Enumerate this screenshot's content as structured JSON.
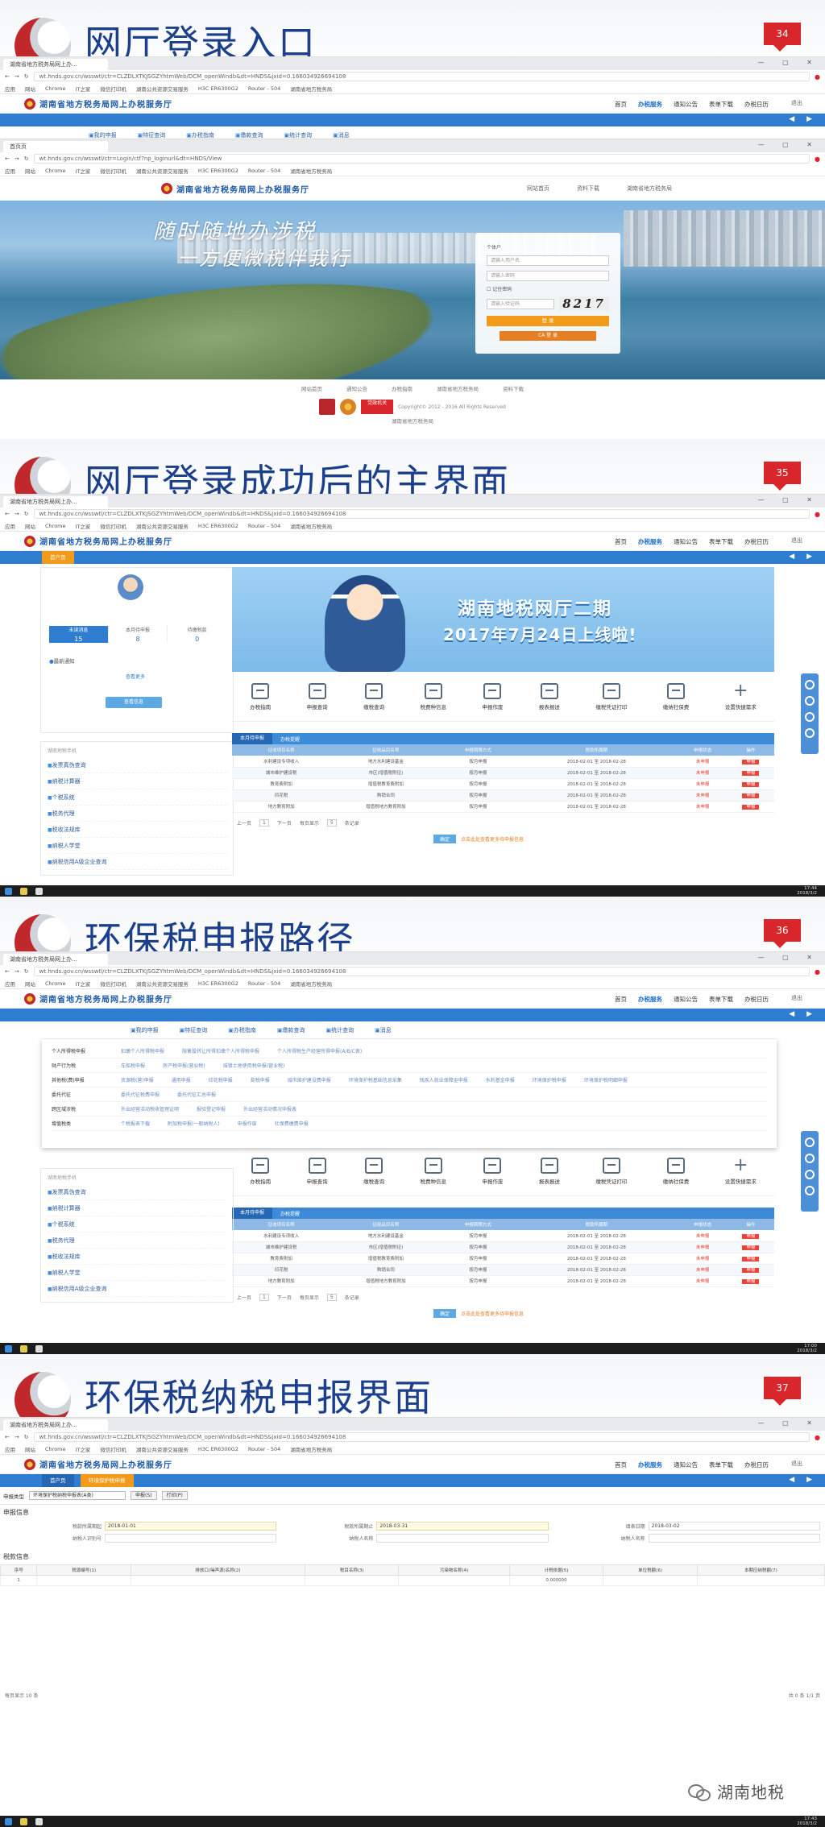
{
  "slides": [
    {
      "title": "网厅登录入口",
      "page": "34",
      "browser": {
        "tab": "湖南省地方税务局网上办...",
        "tab2": "首页页",
        "url": "wt.hnds.gov.cn/wsswtl/ctr=CLZDLXTKJSGZYhtmWeb/DCM_openWindb&dt=HNDS&jxid=0.166034926694108",
        "url2": "wt.hnds.gov.cn/wsswtl/ctr=Login/ctf?np_loginurl&dt=HNDS/View",
        "bookmarks": [
          "应用",
          "网站",
          "Chrome",
          "IT之家",
          "微信打印机",
          "湖南公共资源交易服务",
          "H3C ER6300G2",
          "Router - 504",
          "湖南省地方税务局"
        ]
      },
      "site_name": "湖南省地方税务局网上办税服务厅",
      "topnav": [
        "首页",
        "办税服务",
        "通知公告",
        "表单下载",
        "办税日历"
      ],
      "user": "退出",
      "subtabs": [
        "我的申报",
        "特征查询",
        "办税指南",
        "缴款查询",
        "统计查询",
        "消息"
      ],
      "login_links": [
        "网站首页",
        "资料下载",
        "湖南省地方税务局"
      ],
      "slogan1": "随时随地办涉税",
      "slogan2": "一方便微税伴我行",
      "login": {
        "tab": "个体户",
        "user_placeholder": "请输入用户名",
        "pwd_placeholder": "请输入密码",
        "remember": "记住密码",
        "captcha_placeholder": "请输入验证码",
        "captcha": "8217",
        "login_btn": "登 录",
        "cert_btn": "CA 登 录"
      },
      "footer_links": [
        "网站首页",
        "通知公告",
        "办税指南",
        "湖南省地方税务局",
        "资料下载"
      ],
      "copyright": "Copyright© 2012 - 2016 All Rights Reserved",
      "sponsor": "湖南省地方税务局",
      "gov_badge": "党政机关"
    },
    {
      "title": "网厅登录成功后的主界面",
      "page": "35",
      "url": "wt.hnds.gov.cn/wsswtl/ctr=CLZDLXTKJSGZYhtmWeb/DCM_openWindb&dt=HNDS&jxid=0.166034926694108",
      "home_tab": "首户页",
      "stats": [
        {
          "label": "未读消息",
          "num": "15"
        },
        {
          "label": "本月待申报",
          "num": "8"
        },
        {
          "label": "待缴税款",
          "num": "0"
        }
      ],
      "notice": "最新通知",
      "more": "查看更多",
      "small_btn": "查看信息",
      "quicknav_head": "湖南地税手机",
      "quicknav": [
        "发票真伪查询",
        "纳税计算器",
        "个税系统",
        "税务代理",
        "税收法规库",
        "纳税人学堂",
        "纳税信用A级企业查询"
      ],
      "banner1": "湖南地税网厅二期",
      "banner2": "2017年7月24日上线啦!",
      "icons": [
        "办税指南",
        "申报查询",
        "缴税查询",
        "税费种信息",
        "申报作废",
        "报表报送",
        "缴税凭证打印",
        "缴纳社保费",
        "设置快捷需求"
      ],
      "table_tabs": [
        "本月待申报",
        "办税提醒"
      ],
      "columns": [
        "征收项目名称",
        "征收品目名称",
        "申报期限方式",
        "税款所属期",
        "申报状态",
        "操作"
      ],
      "rows": [
        [
          "水利建设专项收入",
          "地方水利建设基金",
          "按月申报",
          "2018-02-01 至 2018-02-28",
          "未申报",
          "申报"
        ],
        [
          "城市维护建设税",
          "市区(增值税附征)",
          "按月申报",
          "2018-02-01 至 2018-02-28",
          "未申报",
          "申报"
        ],
        [
          "教育费附加",
          "增值税教育费附加",
          "按月申报",
          "2018-02-01 至 2018-02-28",
          "未申报",
          "申报"
        ],
        [
          "印花税",
          "购销合同",
          "按月申报",
          "2018-02-01 至 2018-02-28",
          "未申报",
          "申报"
        ],
        [
          "地方教育附加",
          "增值税地方教育附加",
          "按月申报",
          "2018-02-01 至 2018-02-28",
          "未申报",
          "申报"
        ]
      ],
      "pager": [
        "上一页",
        "1",
        "下一页",
        "每页显示",
        "5",
        "条记录"
      ],
      "tip_btn": "确定",
      "tip": "点击此处查看更多待申报信息",
      "taskbar_time": "17:44",
      "taskbar_date": "2018/3/2"
    },
    {
      "title": "环保税申报路径",
      "page": "36",
      "menu": [
        {
          "cat": "个人所得税申报",
          "items": [
            "扣缴个人所得税申报",
            "限售股转让所得扣缴个人所得税申报",
            "个人所得税生产经营所得申报(A/B/C表)"
          ]
        },
        {
          "cat": "财产行为税",
          "items": [
            "车船税申报",
            "房产税申报(营业税)",
            "城镇土地使用税申报(营业税)"
          ]
        },
        {
          "cat": "其他税(费)申报",
          "items": [
            "资源税(营)申报",
            "通用申报",
            "印花税申报",
            "契税申报",
            "城市维护建设费申报",
            "环境保护税基础信息采集",
            "残疾人就业保障金申报",
            "水利基金申报",
            "环境保护税申报",
            "环境保护税明细申报"
          ]
        },
        {
          "cat": "委托代征",
          "items": [
            "委托代征税费申报",
            "委托代征汇总申报"
          ]
        },
        {
          "cat": "跨区域涉税",
          "items": [
            "外出经营活动税收管理证明",
            "报验登记申报",
            "外出经营活动情况申报表"
          ]
        },
        {
          "cat": "增值税类",
          "items": [
            "个税报表下载",
            "附加税申报(一般纳税人)",
            "申报作废",
            "社保费缴费申报"
          ]
        }
      ],
      "taskbar_time": "17:00",
      "taskbar_date": "2018/3/2"
    },
    {
      "title": "环保税纳税申报界面",
      "page": "37",
      "home_tab": "首户页",
      "active_tab": "环境保护税申报",
      "form_label": "申报类型",
      "form_select": "环境保护税纳税申报表(A类)",
      "btn_save": "申报(S)",
      "btn_print": "打印(P)",
      "section1": "申报信息",
      "fields": [
        {
          "label": "税款所属期起",
          "value": "2018-01-01"
        },
        {
          "label": "税款所属期止",
          "value": "2018-03-31"
        },
        {
          "label": "填表日期",
          "value": "2018-03-02"
        },
        {
          "label": "纳税人识别号",
          "value": ""
        },
        {
          "label": "纳税人名称",
          "value": ""
        },
        {
          "label": "纳税人名称",
          "value": ""
        }
      ],
      "section2": "税款信息",
      "tax_columns": [
        "序号",
        "税源编号(1)",
        "排放口(噪声源)名称(2)",
        "税目名称(3)",
        "污染物名称(4)",
        "计税依据(5)",
        "单位税额(6)",
        "本期应纳税额(7)"
      ],
      "tax_row": [
        "1",
        "",
        "",
        "",
        "",
        "0.000000",
        "",
        ""
      ],
      "footer_left": "每页显示 10 条",
      "footer_right": "共 0 条 1/1 页",
      "taskbar_time": "17:43",
      "taskbar_date": "2018/3/2"
    }
  ],
  "watermark": "湖南地税"
}
